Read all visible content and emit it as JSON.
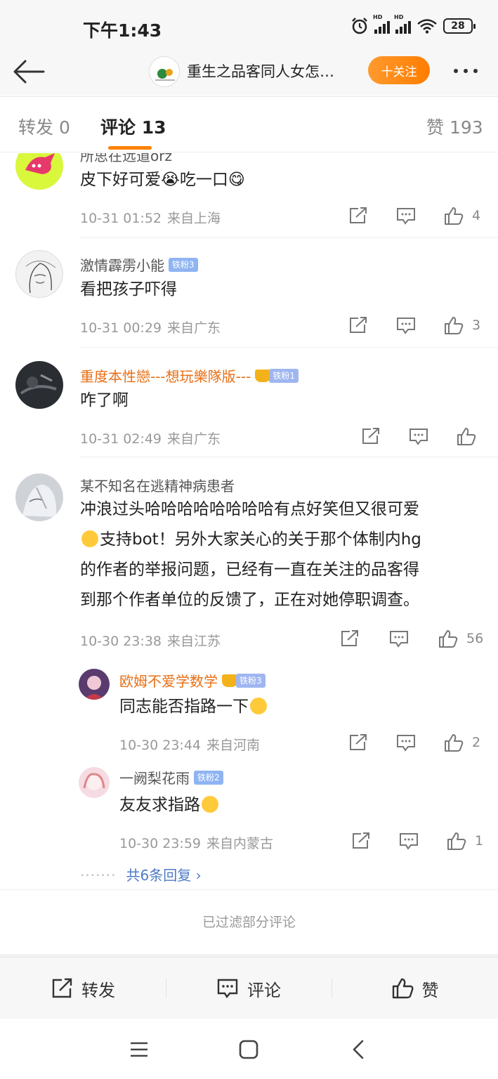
{
  "status": {
    "time": "下午1:43",
    "battery": "28"
  },
  "nav": {
    "title": "重生之品客同人女怎…",
    "follow_label": "十关注"
  },
  "tabs": {
    "repost": "转发 0",
    "comment": "评论 13",
    "like": "赞 193"
  },
  "comments": [
    {
      "user": "所思在远道orz",
      "text": "皮下好可爱😭吃一口😋",
      "time": "10-31 01:52",
      "location": "来自上海",
      "likes": "4"
    },
    {
      "user": "激情霹雳小能",
      "badge": "铁粉3",
      "text": "看把孩子吓得",
      "time": "10-31 00:29",
      "location": "来自广东",
      "likes": "3"
    },
    {
      "user": "重度本性戀---想玩樂隊版---",
      "badge": "铁粉1",
      "text": "咋了啊",
      "time": "10-31 02:49",
      "location": "来自广东",
      "likes": ""
    },
    {
      "user": "某不知名在逃精神病患者",
      "text_lines": [
        "冲浪过头哈哈哈哈哈哈哈哈有点好笑但又很可爱",
        "支持bot！另外大家关心的关于那个体制内hg",
        "的作者的举报问题，已经有一直在关注的品客得",
        "到那个作者单位的反馈了，正在对她停职调查。"
      ],
      "time": "10-30 23:38",
      "location": "来自江苏",
      "likes": "56"
    }
  ],
  "replies": [
    {
      "user": "欧姆不爱学数学",
      "badge": "铁粉3",
      "text": "同志能否指路一下",
      "time": "10-30 23:44",
      "location": "来自河南",
      "likes": "2"
    },
    {
      "user": "一阙梨花雨",
      "badge": "铁粉2",
      "text": "友友求指路",
      "time": "10-30 23:59",
      "location": "来自内蒙古",
      "likes": "1"
    }
  ],
  "more_replies": "共6条回复",
  "filtered_note": "已过滤部分评论",
  "actionbar": {
    "repost": "转发",
    "comment": "评论",
    "like": "赞"
  },
  "colors": {
    "accent": "#ff8200",
    "username_highlight": "#e86f15",
    "link": "#4f7ac8"
  },
  "icons": [
    "back-arrow-icon",
    "more-dots-icon",
    "share-icon",
    "comment-icon",
    "like-icon",
    "menu-icon",
    "home-icon",
    "back-icon"
  ]
}
